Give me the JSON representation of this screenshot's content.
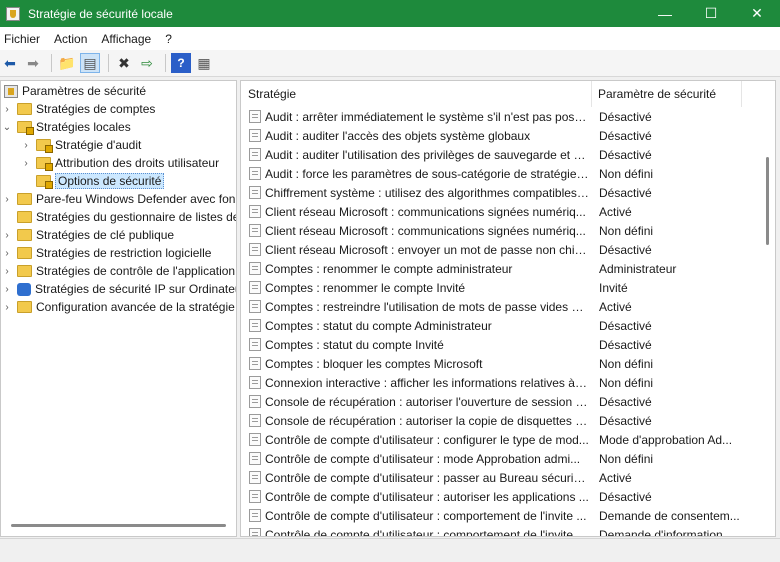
{
  "window": {
    "title": "Stratégie de sécurité locale",
    "minimize_glyph": "—",
    "maximize_glyph": "☐",
    "close_glyph": "✕"
  },
  "menu": [
    "Fichier",
    "Action",
    "Affichage",
    "?"
  ],
  "toolbar": {
    "icons": [
      "back-arrow-icon",
      "forward-arrow-icon",
      "up-folder-icon",
      "show-hide-tree-icon",
      "delete-icon",
      "export-list-icon",
      "help-icon",
      "properties-icon"
    ]
  },
  "tree": {
    "root": "Paramètres de sécurité",
    "items": [
      {
        "label": "Stratégies de comptes",
        "level": 1,
        "expander": "closed",
        "icon": "folder"
      },
      {
        "label": "Stratégies locales",
        "level": 1,
        "expander": "open",
        "icon": "folder-lock"
      },
      {
        "label": "Stratégie d'audit",
        "level": 2,
        "expander": "closed",
        "icon": "folder-lock"
      },
      {
        "label": "Attribution des droits utilisateur",
        "level": 2,
        "expander": "closed",
        "icon": "folder-lock"
      },
      {
        "label": "Options de sécurité",
        "level": 2,
        "expander": "none",
        "icon": "folder-lock",
        "selected": true
      },
      {
        "label": "Pare-feu Windows Defender avec fon",
        "level": 1,
        "expander": "closed",
        "icon": "folder"
      },
      {
        "label": "Stratégies du gestionnaire de listes de",
        "level": 1,
        "expander": "none",
        "icon": "folder"
      },
      {
        "label": "Stratégies de clé publique",
        "level": 1,
        "expander": "closed",
        "icon": "folder"
      },
      {
        "label": "Stratégies de restriction logicielle",
        "level": 1,
        "expander": "closed",
        "icon": "folder"
      },
      {
        "label": "Stratégies de contrôle de l'application",
        "level": 1,
        "expander": "closed",
        "icon": "folder"
      },
      {
        "label": "Stratégies de sécurité IP sur Ordinateu",
        "level": 1,
        "expander": "closed",
        "icon": "ip-security"
      },
      {
        "label": "Configuration avancée de la stratégie",
        "level": 1,
        "expander": "closed",
        "icon": "folder"
      }
    ]
  },
  "list": {
    "columns": [
      "Stratégie",
      "Paramètre de sécurité"
    ],
    "sort_glyph": "^",
    "rows": [
      {
        "policy": "Audit : arrêter immédiatement le système s'il n'est pas possi...",
        "setting": "Désactivé"
      },
      {
        "policy": "Audit : auditer l'accès des objets système globaux",
        "setting": "Désactivé"
      },
      {
        "policy": "Audit : auditer l'utilisation des privilèges de sauvegarde et d...",
        "setting": "Désactivé"
      },
      {
        "policy": "Audit : force les paramètres de sous-catégorie de stratégie d...",
        "setting": "Non défini"
      },
      {
        "policy": "Chiffrement système : utilisez des algorithmes compatibles ...",
        "setting": "Désactivé"
      },
      {
        "policy": "Client réseau Microsoft : communications signées numériq...",
        "setting": "Activé"
      },
      {
        "policy": "Client réseau Microsoft : communications signées numériq...",
        "setting": "Non défini"
      },
      {
        "policy": "Client réseau Microsoft : envoyer un mot de passe non chiff...",
        "setting": "Désactivé"
      },
      {
        "policy": "Comptes : renommer le compte administrateur",
        "setting": "Administrateur"
      },
      {
        "policy": "Comptes : renommer le compte Invité",
        "setting": "Invité"
      },
      {
        "policy": "Comptes : restreindre l'utilisation de mots de passe vides pa...",
        "setting": "Activé"
      },
      {
        "policy": "Comptes : statut du compte Administrateur",
        "setting": "Désactivé"
      },
      {
        "policy": "Comptes : statut du compte Invité",
        "setting": "Désactivé"
      },
      {
        "policy": "Comptes : bloquer les comptes Microsoft",
        "setting": "Non défini"
      },
      {
        "policy": "Connexion interactive : afficher les informations relatives à l'...",
        "setting": "Non défini"
      },
      {
        "policy": "Console de récupération : autoriser l'ouverture de session d'...",
        "setting": "Désactivé"
      },
      {
        "policy": "Console de récupération : autoriser la copie de disquettes et ...",
        "setting": "Désactivé"
      },
      {
        "policy": "Contrôle de compte d'utilisateur : configurer le type de mod...",
        "setting": "Mode d'approbation Ad..."
      },
      {
        "policy": "Contrôle de compte d'utilisateur : mode Approbation admi...",
        "setting": "Non défini"
      },
      {
        "policy": "Contrôle de compte d'utilisateur : passer au Bureau sécurisé ...",
        "setting": "Activé"
      },
      {
        "policy": "Contrôle de compte d'utilisateur : autoriser les applications ...",
        "setting": "Désactivé"
      },
      {
        "policy": "Contrôle de compte d'utilisateur : comportement de l'invite ...",
        "setting": "Demande de consentem..."
      },
      {
        "policy": "Contrôle de compte d'utilisateur : comportement de l'invite ...",
        "setting": "Demande d'information..."
      }
    ]
  },
  "colors": {
    "titlebar": "#1e8a3c",
    "selection": "#cce8ff"
  }
}
